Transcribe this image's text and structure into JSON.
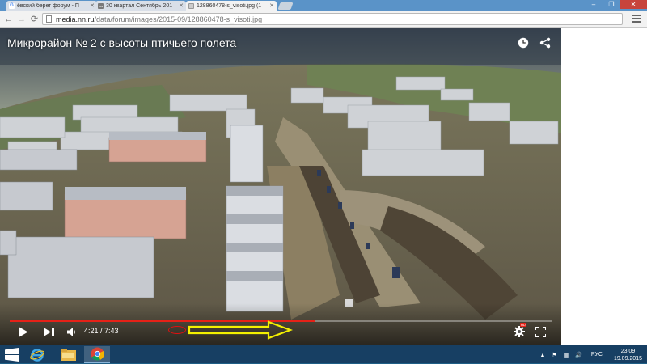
{
  "browser": {
    "tabs": [
      {
        "title": "ёвский берег форум - П",
        "favicon": "G",
        "favicon_color": "#4285f4",
        "active": false
      },
      {
        "title": "30 квартал Сентябрь 201",
        "favicon": "nn",
        "favicon_color": "#7a7a7a",
        "active": false
      },
      {
        "title": "128860478-s_visoti.jpg (1",
        "favicon": "",
        "favicon_color": "#cccccc",
        "active": true
      }
    ],
    "url_host": "media.nn.ru",
    "url_path": "/data/forum/images/2015-09/128860478-s_visoti.jpg",
    "window_controls": [
      "–",
      "❐",
      "✕"
    ]
  },
  "video": {
    "title": "Микрорайон № 2 с высоты птичьего полета",
    "current_time": "4:21",
    "duration": "7:43",
    "time_separator": " / ",
    "progress_fraction": 0.564,
    "hd_badge": "HD",
    "icons": [
      "clock-icon",
      "share-icon",
      "play-icon",
      "next-icon",
      "volume-icon",
      "settings-gear-icon",
      "fullscreen-icon"
    ]
  },
  "annotation": {
    "ellipse_color": "#e01010",
    "arrow_color": "#f4f000"
  },
  "taskbar": {
    "language": "РУС",
    "time": "23:09",
    "date": "19.09.2015",
    "apps": [
      "file-explorer-icon",
      "internet-explorer-icon",
      "chrome-icon"
    ]
  },
  "colors": {
    "progress": "#e62117",
    "taskbar": "#173f63",
    "titlebar": "#5a93c8"
  }
}
